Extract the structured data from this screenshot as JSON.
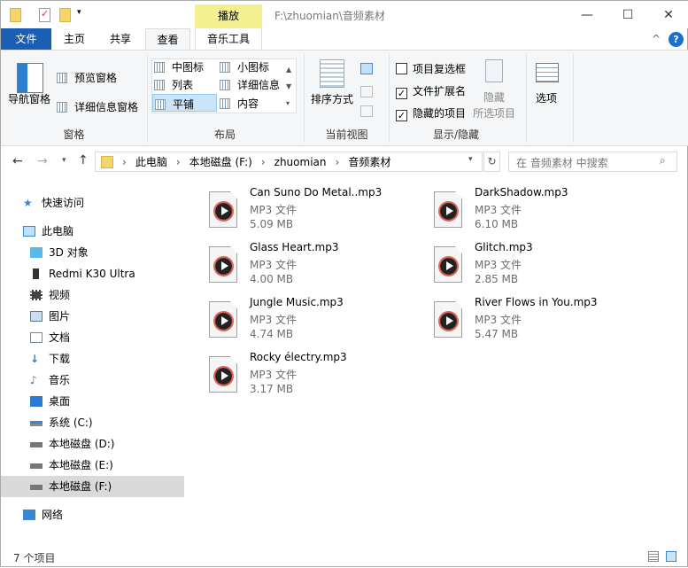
{
  "title_bar": {
    "contextual_tab": "播放",
    "path": "F:\\zhuomian\\音频素材",
    "minimize": "—",
    "maximize": "☐",
    "close": "✕"
  },
  "tabs": [
    {
      "label": "文件"
    },
    {
      "label": "主页"
    },
    {
      "label": "共享"
    },
    {
      "label": "查看"
    },
    {
      "label": "音乐工具"
    }
  ],
  "ribbon": {
    "panes": {
      "nav_pane": "导航窗格",
      "preview": "预览窗格",
      "details": "详细信息窗格",
      "group": "窗格"
    },
    "layout": {
      "items": [
        "中图标",
        "小图标",
        "列表",
        "详细信息",
        "平铺",
        "内容"
      ],
      "selected": "平铺",
      "group": "布局"
    },
    "view": {
      "sort": "排序方式",
      "group": "当前视图"
    },
    "show": {
      "checkbox_items": "项目复选框",
      "file_ext": "文件扩展名",
      "hidden_items": "隐藏的项目",
      "hide_selected_1": "隐藏",
      "hide_selected_2": "所选项目",
      "group": "显示/隐藏",
      "checks": [
        false,
        true,
        true
      ]
    },
    "options": "选项"
  },
  "address": {
    "crumbs": [
      "此电脑",
      "本地磁盘 (F:)",
      "zhuomian",
      "音频素材"
    ],
    "search_placeholder": "在 音频素材 中搜索"
  },
  "sidebar": {
    "quick": "快速访问",
    "pc": "此电脑",
    "items": [
      "3D 对象",
      "Redmi K30 Ultra",
      "视频",
      "图片",
      "文档",
      "下载",
      "音乐",
      "桌面",
      "系统 (C:)",
      "本地磁盘 (D:)",
      "本地磁盘 (E:)",
      "本地磁盘 (F:)"
    ],
    "network": "网络"
  },
  "files": [
    {
      "name": "Can Suno Do Metal..mp3",
      "type": "MP3 文件",
      "size": "5.09 MB"
    },
    {
      "name": "DarkShadow.mp3",
      "type": "MP3 文件",
      "size": "6.10 MB"
    },
    {
      "name": "Glass Heart.mp3",
      "type": "MP3 文件",
      "size": "4.00 MB"
    },
    {
      "name": "Glitch.mp3",
      "type": "MP3 文件",
      "size": "2.85 MB"
    },
    {
      "name": "Jungle Music.mp3",
      "type": "MP3 文件",
      "size": "4.74 MB"
    },
    {
      "name": "River Flows in You.mp3",
      "type": "MP3 文件",
      "size": "5.47 MB"
    },
    {
      "name": "Rocky électry.mp3",
      "type": "MP3 文件",
      "size": "3.17 MB"
    }
  ],
  "status": {
    "count": "7 个项目"
  }
}
